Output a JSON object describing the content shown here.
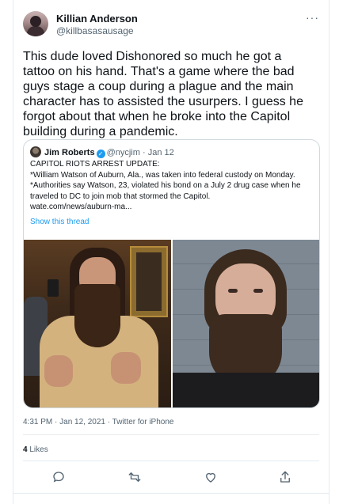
{
  "tweet": {
    "author_name": "Killian Anderson",
    "author_handle": "@killbasasausage",
    "more_label": "···",
    "text": "This dude loved Dishonored so much he got a tattoo on his hand. That's a game where the bad guys stage a coup during a plague and the main character has to assisted the usurpers. I guess he forgot about that when he broke into the Capitol building during a pandemic.",
    "timestamp": "4:31 PM · Jan 12, 2021 · Twitter for iPhone",
    "likes_count": "4",
    "likes_label": "Likes"
  },
  "quoted": {
    "author_name": "Jim Roberts",
    "verified_mark": "✓",
    "author_handle": "@nycjim",
    "date": "· Jan 12",
    "lines": [
      "CAPITOL RIOTS ARREST UPDATE:",
      "*William Watson of Auburn, Ala., was taken into federal custody on Monday.",
      "*Authorities say Watson, 23, violated his bond on a July 2 drug case when he traveled to DC to join mob that stormed the Capitol.",
      "wate.com/news/auburn-ma..."
    ],
    "show_thread": "Show this thread"
  },
  "actions": [
    "reply-icon",
    "retweet-icon",
    "like-icon",
    "share-icon"
  ],
  "colors": {
    "accent": "#1d9bf0",
    "text": "#0f1419",
    "secondary": "#536471",
    "border": "#cfd9de"
  }
}
